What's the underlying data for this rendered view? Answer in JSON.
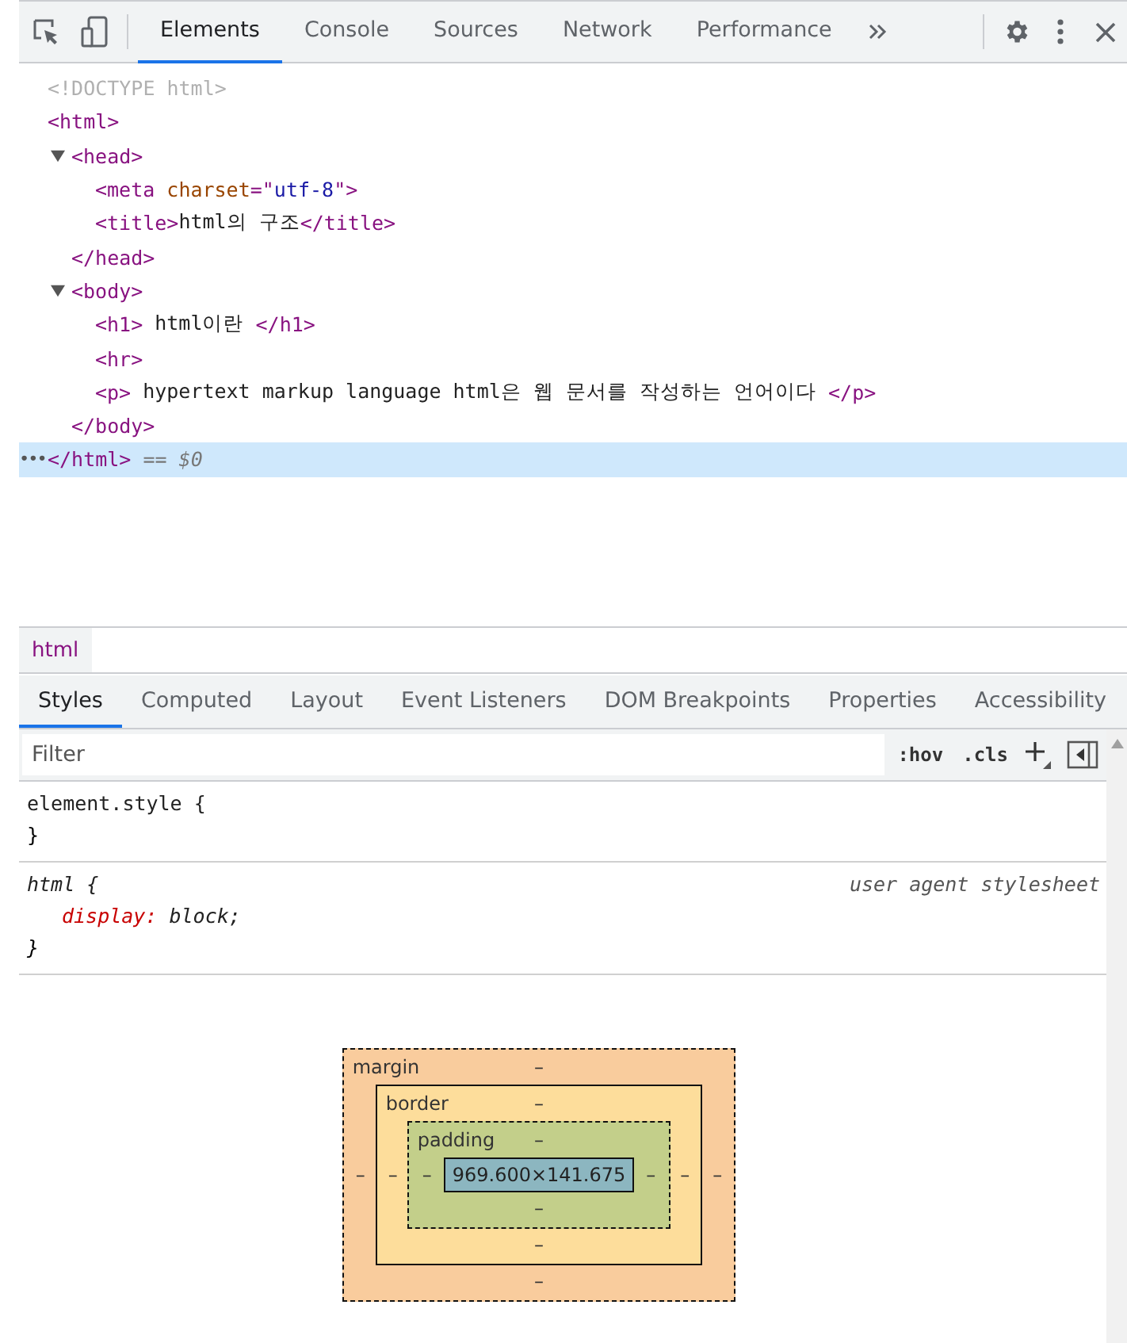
{
  "toolbar": {
    "tabs": [
      {
        "label": "Elements",
        "selected": true
      },
      {
        "label": "Console",
        "selected": false
      },
      {
        "label": "Sources",
        "selected": false
      },
      {
        "label": "Network",
        "selected": false
      },
      {
        "label": "Performance",
        "selected": false
      }
    ]
  },
  "dom_tree": [
    {
      "selected": false,
      "line": [
        {
          "kind": "doctype",
          "text": "<!DOCTYPE html>"
        }
      ]
    },
    {
      "selected": false,
      "line": [
        {
          "kind": "tag",
          "text": "<html>"
        }
      ],
      "children": [
        {
          "selected": false,
          "expanded": true,
          "line": [
            {
              "kind": "tag",
              "text": "<head>"
            }
          ],
          "children": [
            {
              "selected": false,
              "line": [
                {
                  "kind": "tag",
                  "text": "<meta"
                },
                {
                  "kind": "attr",
                  "text": " charset"
                },
                {
                  "kind": "tag",
                  "text": "=\""
                },
                {
                  "kind": "value",
                  "text": "utf-8"
                },
                {
                  "kind": "tag",
                  "text": "\">"
                }
              ]
            },
            {
              "selected": false,
              "line": [
                {
                  "kind": "tag",
                  "text": "<title>"
                },
                {
                  "kind": "text",
                  "text": "html의 구조"
                },
                {
                  "kind": "tag",
                  "text": "</title>"
                }
              ]
            }
          ],
          "end": {
            "selected": false,
            "line": [
              {
                "kind": "tag",
                "text": "</head>"
              }
            ]
          }
        },
        {
          "selected": false,
          "expanded": true,
          "line": [
            {
              "kind": "tag",
              "text": "<body>"
            }
          ],
          "children": [
            {
              "selected": false,
              "line": [
                {
                  "kind": "tag",
                  "text": "<h1>"
                },
                {
                  "kind": "text",
                  "text": " html이란 "
                },
                {
                  "kind": "tag",
                  "text": "</h1>"
                }
              ]
            },
            {
              "selected": false,
              "line": [
                {
                  "kind": "tag",
                  "text": "<hr>"
                }
              ]
            },
            {
              "selected": false,
              "line": [
                {
                  "kind": "tag",
                  "text": "<p>"
                },
                {
                  "kind": "text",
                  "text": " hypertext markup language html은 웹 문서를 작성하는 언어이다 "
                },
                {
                  "kind": "tag",
                  "text": "</p>"
                }
              ]
            }
          ],
          "end": {
            "selected": false,
            "line": [
              {
                "kind": "tag",
                "text": "</body>"
              }
            ]
          }
        }
      ],
      "end": {
        "selected": true,
        "gutter": "•••",
        "line": [
          {
            "kind": "tag",
            "text": "</html>"
          },
          {
            "kind": "note",
            "text": " == $0"
          }
        ]
      }
    }
  ],
  "breadcrumb": [
    "html"
  ],
  "sub_tabs": [
    {
      "label": "Styles",
      "selected": true
    },
    {
      "label": "Computed",
      "selected": false
    },
    {
      "label": "Layout",
      "selected": false
    },
    {
      "label": "Event Listeners",
      "selected": false
    },
    {
      "label": "DOM Breakpoints",
      "selected": false
    },
    {
      "label": "Properties",
      "selected": false
    },
    {
      "label": "Accessibility",
      "selected": false
    }
  ],
  "filter": {
    "placeholder": "Filter",
    "hov": ":hov",
    "cls": ".cls"
  },
  "rules": [
    {
      "selector": "element.style {",
      "user_agent": false,
      "close": "}"
    },
    {
      "selector": "html {",
      "user_agent": true,
      "origin": "user agent stylesheet",
      "declarations": [
        {
          "property": "display:",
          "value": " block;"
        }
      ],
      "close": "}"
    }
  ],
  "box_model": {
    "margin": {
      "label": "margin",
      "top": "–",
      "right": "–",
      "bottom": "–",
      "left": "–"
    },
    "border": {
      "label": "border",
      "top": "–",
      "right": "–",
      "bottom": "–",
      "left": "–"
    },
    "padding": {
      "label": "padding",
      "top": "–",
      "right": "–",
      "bottom": "–",
      "left": "–"
    },
    "content": "969.600×141.675"
  }
}
